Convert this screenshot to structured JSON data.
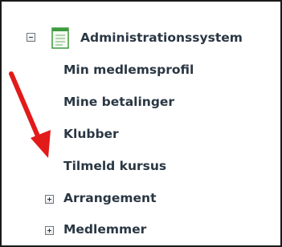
{
  "tree": {
    "root": {
      "label": "Administrationssystem",
      "state": "expanded",
      "icon": "document-list-icon"
    },
    "children": [
      {
        "label": "Min medlemsprofil",
        "type": "leaf"
      },
      {
        "label": "Mine betalinger",
        "type": "leaf"
      },
      {
        "label": "Klubber",
        "type": "leaf"
      },
      {
        "label": "Tilmeld kursus",
        "type": "leaf"
      },
      {
        "label": "Arrangement",
        "type": "folder",
        "state": "collapsed"
      },
      {
        "label": "Medlemmer",
        "type": "folder",
        "state": "collapsed"
      }
    ]
  },
  "colors": {
    "text": "#2a3744",
    "arrow": "#e31a1a",
    "icon_green": "#3e9a3e",
    "frame": "#1a1a1a"
  }
}
